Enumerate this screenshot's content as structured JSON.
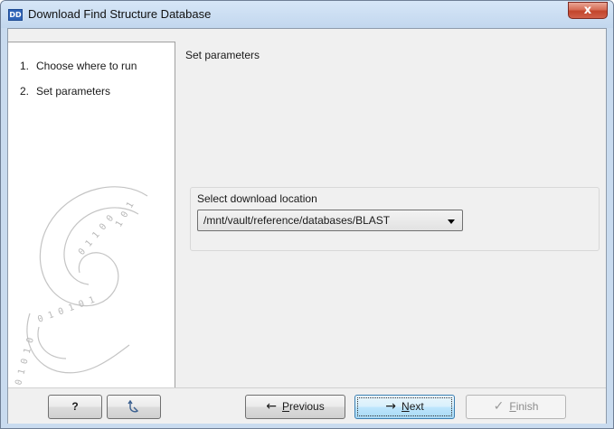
{
  "window": {
    "title": "Download Find Structure Database",
    "icon_text": "DD",
    "close_glyph": "x"
  },
  "steps": [
    {
      "number": "1.",
      "label": "Choose where to run"
    },
    {
      "number": "2.",
      "label": "Set parameters"
    }
  ],
  "panel": {
    "title": "Set parameters",
    "group_label": "Select download location",
    "download_location": "/mnt/vault/reference/databases/BLAST"
  },
  "buttons": {
    "help": "?",
    "previous_mnemonic": "P",
    "previous_rest": "revious",
    "next_mnemonic": "N",
    "next_rest": "ext",
    "finish_mnemonic": "F",
    "finish_rest": "inish"
  },
  "icons": {
    "help": "question-icon",
    "reset": "reset-arrow-icon",
    "previous": "arrow-left-icon",
    "next": "arrow-right-icon",
    "finish": "checkmark-icon",
    "decoration": "binary-swirl-icon"
  }
}
